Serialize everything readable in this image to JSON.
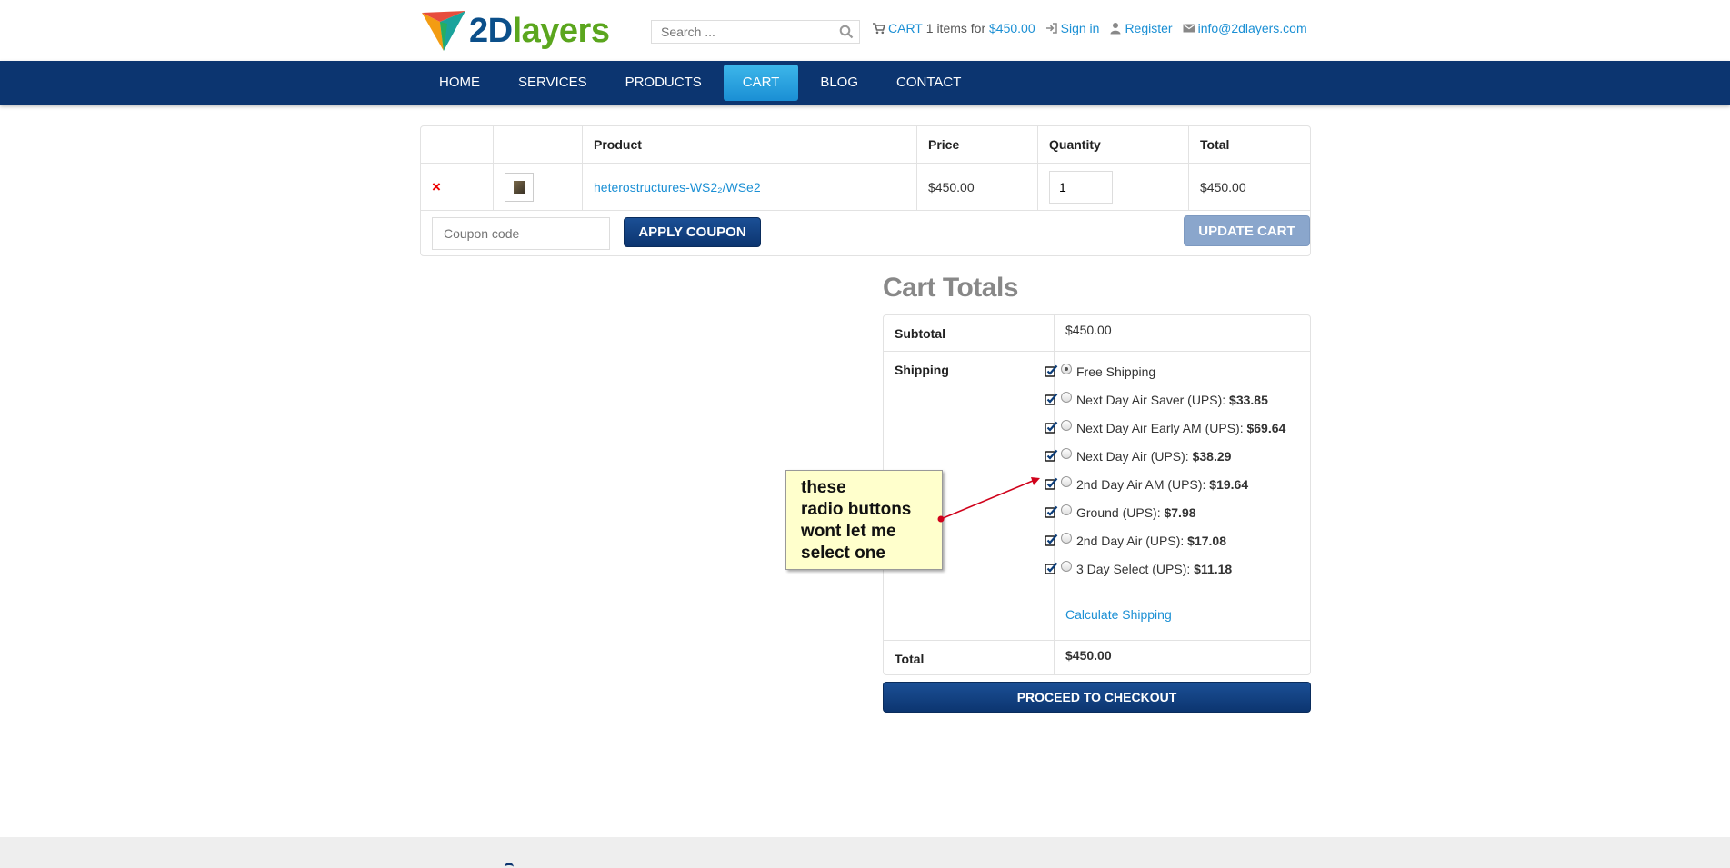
{
  "header": {
    "logo": {
      "part1": "2D",
      "part2": "layers"
    },
    "search": {
      "placeholder": "Search ..."
    },
    "cart": {
      "label": "CART",
      "count_text": "1",
      "items_text": "items for",
      "amount": "$450.00"
    },
    "signin": "Sign in",
    "register": "Register",
    "email": "info@2dlayers.com"
  },
  "nav": {
    "items": [
      "HOME",
      "SERVICES",
      "PRODUCTS",
      "CART",
      "BLOG",
      "CONTACT"
    ],
    "active": "CART"
  },
  "cart_table": {
    "headers": {
      "product": "Product",
      "price": "Price",
      "quantity": "Quantity",
      "total": "Total"
    },
    "item": {
      "remove": "×",
      "product_name": "heterostructures-WS2₂/WSe2",
      "price": "$450.00",
      "quantity": "1",
      "total": "$450.00"
    },
    "coupon_placeholder": "Coupon code",
    "apply_coupon": "APPLY COUPON",
    "update_cart": "UPDATE CART"
  },
  "cart_totals": {
    "title": "Cart Totals",
    "subtotal_label": "Subtotal",
    "subtotal_value": "$450.00",
    "shipping_label": "Shipping",
    "shipping_options": [
      {
        "name": "Free Shipping",
        "price": "",
        "selected": true
      },
      {
        "name": "Next Day Air Saver (UPS): ",
        "price": "$33.85",
        "selected": false
      },
      {
        "name": "Next Day Air Early AM (UPS): ",
        "price": "$69.64",
        "selected": false
      },
      {
        "name": "Next Day Air (UPS): ",
        "price": "$38.29",
        "selected": false
      },
      {
        "name": "2nd Day Air AM (UPS): ",
        "price": "$19.64",
        "selected": false
      },
      {
        "name": "Ground (UPS): ",
        "price": "$7.98",
        "selected": false
      },
      {
        "name": "2nd Day Air (UPS): ",
        "price": "$17.08",
        "selected": false
      },
      {
        "name": "3 Day Select (UPS): ",
        "price": "$11.18",
        "selected": false
      }
    ],
    "calculate_shipping": "Calculate Shipping",
    "total_label": "Total",
    "total_value": "$450.00",
    "checkout": "PROCEED TO CHECKOUT"
  },
  "annotation": {
    "lines": [
      "these",
      "radio buttons",
      "wont let me",
      "select one"
    ]
  },
  "colors": {
    "navbar": "#0c3570",
    "active_tab": "#1a8fd4",
    "link": "#1a8fd4",
    "logo_blue": "#0b4f8a",
    "logo_green": "#5ba61e",
    "note_bg": "#ffffcc",
    "annotation_arrow": "#d0021b"
  }
}
